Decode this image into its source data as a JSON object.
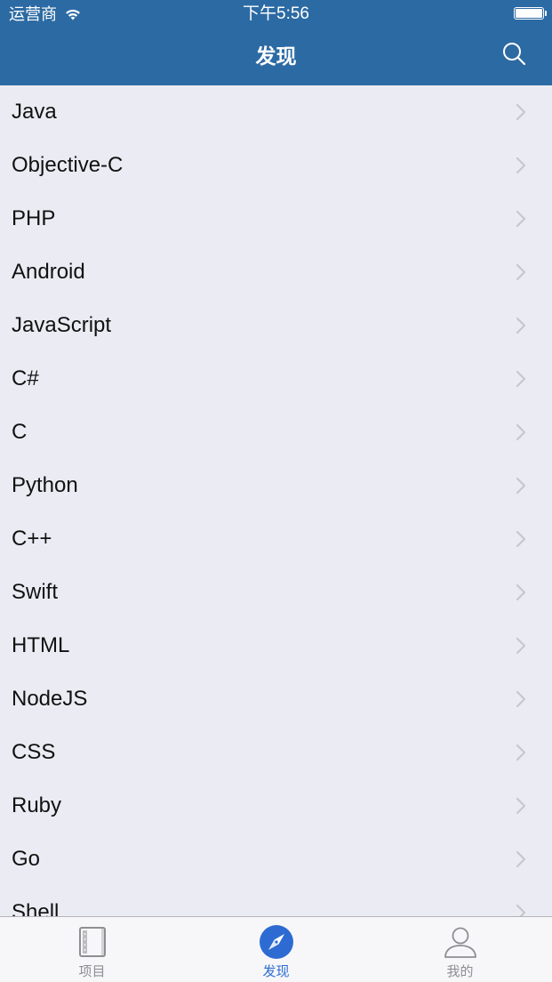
{
  "status_bar": {
    "carrier": "运营商",
    "time": "下午5:56",
    "battery_level": 1.0
  },
  "nav": {
    "title": "发现",
    "search_icon": "search-icon"
  },
  "items": [
    {
      "label": "Java"
    },
    {
      "label": "Objective-C"
    },
    {
      "label": "PHP"
    },
    {
      "label": "Android"
    },
    {
      "label": "JavaScript"
    },
    {
      "label": "C#"
    },
    {
      "label": "C"
    },
    {
      "label": "Python"
    },
    {
      "label": "C++"
    },
    {
      "label": "Swift"
    },
    {
      "label": "HTML"
    },
    {
      "label": "NodeJS"
    },
    {
      "label": "CSS"
    },
    {
      "label": "Ruby"
    },
    {
      "label": "Go"
    },
    {
      "label": "Shell"
    }
  ],
  "tabs": [
    {
      "label": "项目",
      "icon": "notebook-icon",
      "active": false
    },
    {
      "label": "发现",
      "icon": "compass-icon",
      "active": true
    },
    {
      "label": "我的",
      "icon": "person-icon",
      "active": false
    }
  ],
  "colors": {
    "nav_bar": "#2c6aa3",
    "list_background": "#ebebf3",
    "tab_active": "#2d6bd2",
    "tab_inactive": "#8e8e93",
    "chevron": "#c7c7cc"
  }
}
